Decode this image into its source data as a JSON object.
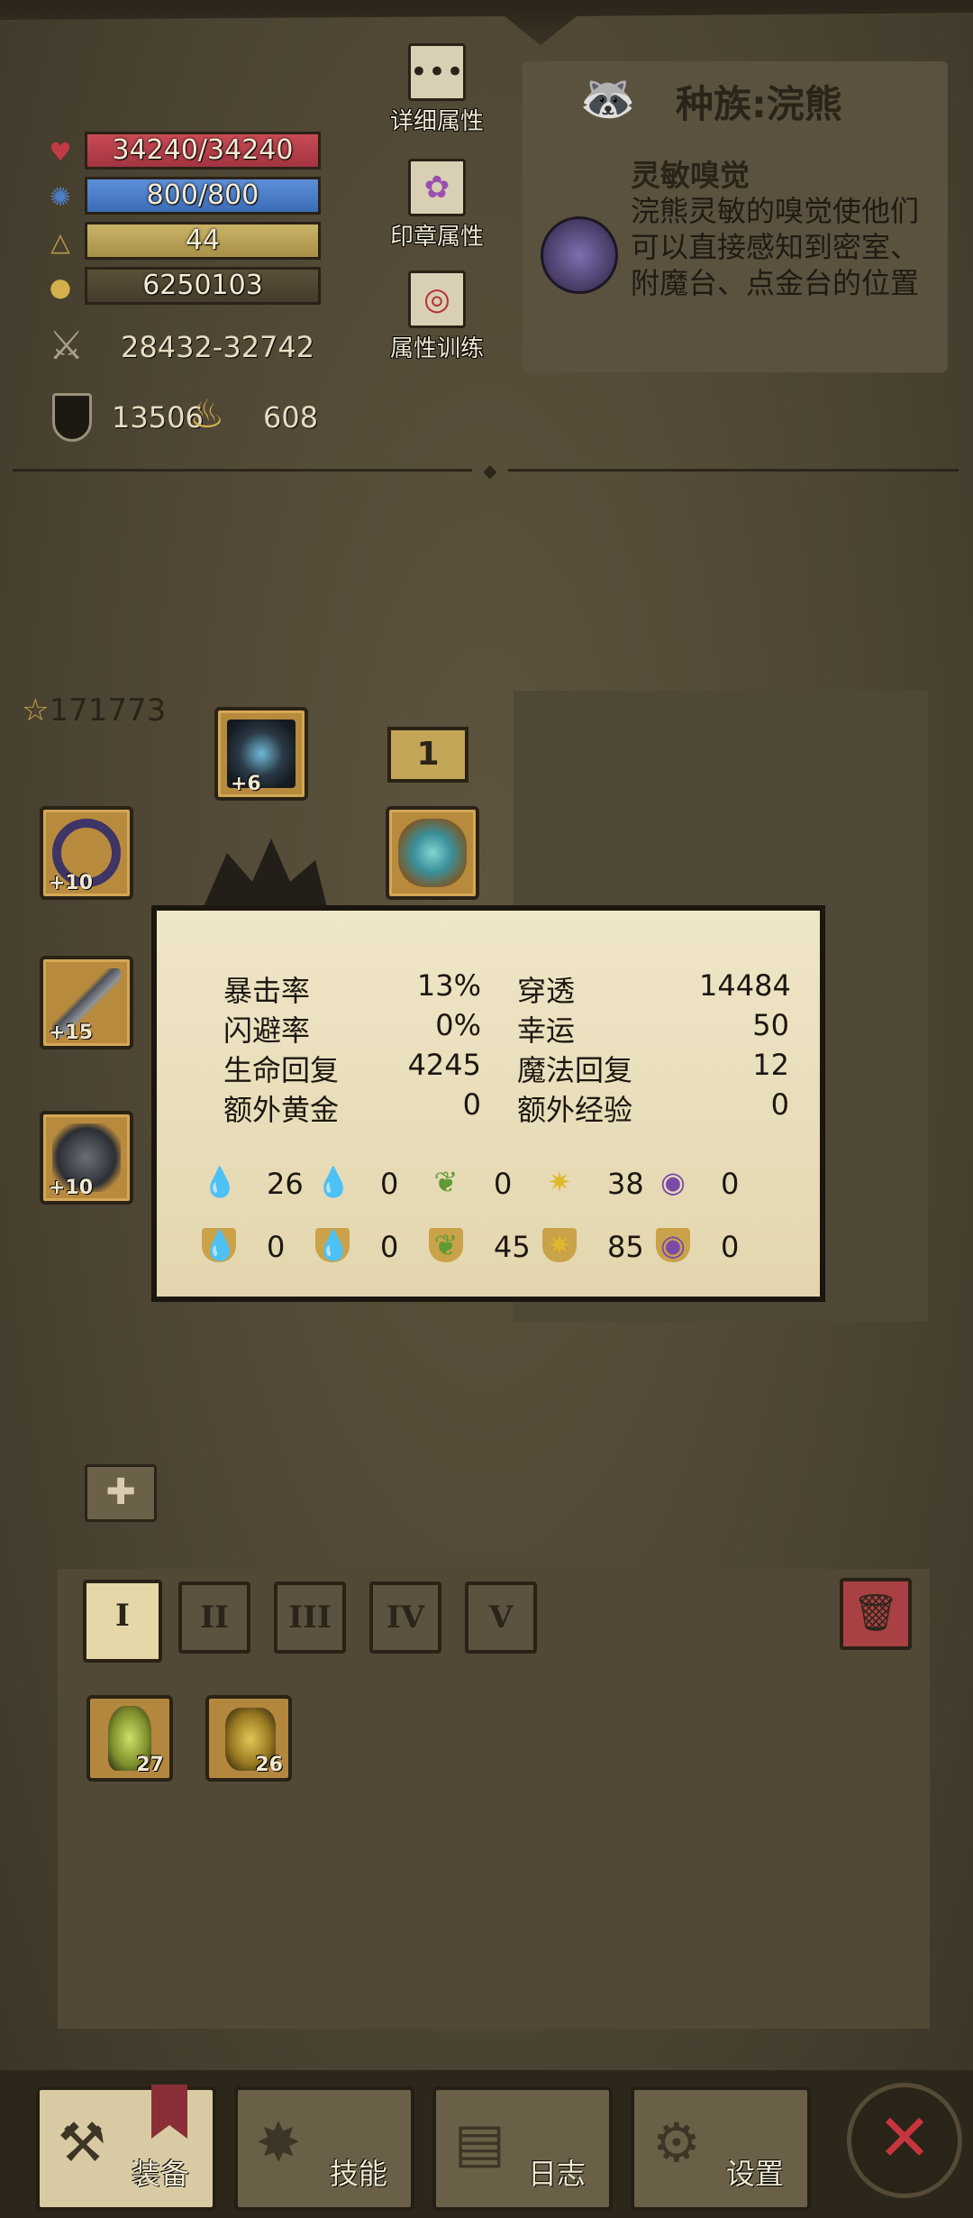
{
  "stats": {
    "hp": "34240/34240",
    "mp": "800/800",
    "level": "44",
    "gold": "6250103",
    "attack": "28432-32742",
    "defense": "13506",
    "magic": "608"
  },
  "side_buttons": {
    "details": "详细属性",
    "seal": "印章属性",
    "training": "属性训练"
  },
  "race": {
    "title": "种族:浣熊",
    "perk_name": "灵敏嗅觉",
    "perk_desc": "浣熊灵敏的嗅觉使他们可以直接感知到密室、附魔台、点金台的位置"
  },
  "equipment": {
    "score": "171773",
    "helmet_level": "+6",
    "ring_level": "+10",
    "weapon_level": "+15",
    "glove_level": "+10",
    "count_box": "1"
  },
  "popup": {
    "rows": [
      {
        "l_name": "暴击率",
        "l_val": "13%",
        "r_name": "穿透",
        "r_val": "14484"
      },
      {
        "l_name": "闪避率",
        "l_val": "0%",
        "r_name": "幸运",
        "r_val": "50"
      },
      {
        "l_name": "生命回复",
        "l_val": "4245",
        "r_name": "魔法回复",
        "r_val": "12"
      },
      {
        "l_name": "额外黄金",
        "l_val": "0",
        "r_name": "额外经验",
        "r_val": "0"
      }
    ],
    "attack_elements": [
      "26",
      "0",
      "0",
      "38",
      "0"
    ],
    "resist_elements": [
      "0",
      "0",
      "45",
      "85",
      "0"
    ],
    "element_icons": [
      "fire-drop-icon",
      "water-drop-icon",
      "leaf-icon",
      "lightning-icon",
      "arcane-swirl-icon"
    ],
    "element_colors": [
      "#d8322a",
      "#3a7fd0",
      "#5f9a32",
      "#e0b82c",
      "#7b4aa8"
    ]
  },
  "bag": {
    "tabs": [
      "I",
      "II",
      "III",
      "IV",
      "V"
    ],
    "items": [
      {
        "count": "27",
        "icon": "potion-icon"
      },
      {
        "count": "26",
        "icon": "armor-icon"
      }
    ]
  },
  "nav": {
    "equip": "装备",
    "skills": "技能",
    "log": "日志",
    "settings": "设置"
  }
}
